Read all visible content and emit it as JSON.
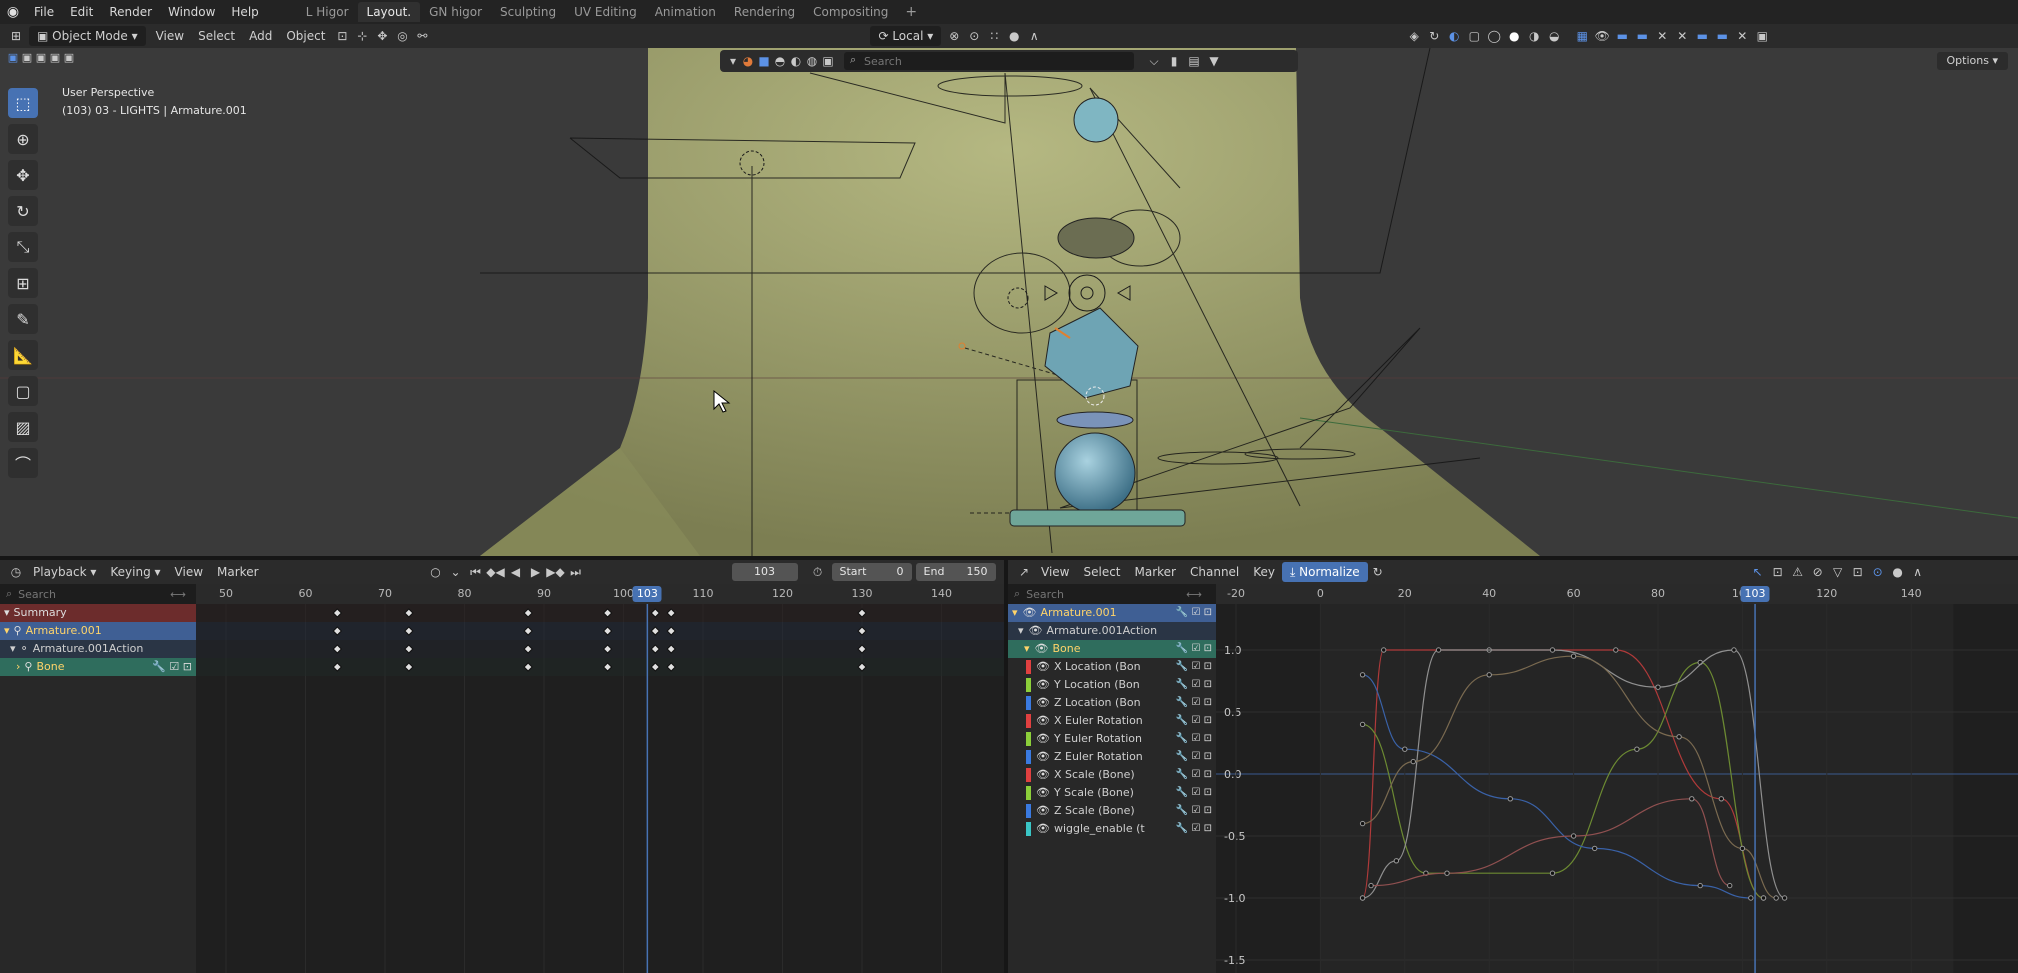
{
  "topbar": {
    "menus": [
      "File",
      "Edit",
      "Render",
      "Window",
      "Help"
    ],
    "workspaces": [
      "L Higor",
      "Layout.",
      "GN higor",
      "Sculpting",
      "UV Editing",
      "Animation",
      "Rendering",
      "Compositing"
    ],
    "active_workspace": "Layout."
  },
  "viewport_header": {
    "mode": "Object Mode",
    "menus": [
      "View",
      "Select",
      "Add",
      "Object"
    ],
    "transform_orientation": "Local",
    "options": "Options"
  },
  "viewport": {
    "perspective": "User Perspective",
    "context": "(103) 03 - LIGHTS | Armature.001",
    "search_placeholder": "Search"
  },
  "dopesheet_header": {
    "menus": [
      "Playback",
      "Keying",
      "View",
      "Marker"
    ],
    "current_frame": "103",
    "start_label": "Start",
    "start_value": "0",
    "end_label": "End",
    "end_value": "150"
  },
  "dopesheet": {
    "search_placeholder": "Search",
    "ruler": [
      50,
      60,
      70,
      80,
      90,
      100,
      110,
      120,
      130,
      140
    ],
    "current_frame": "103",
    "channels": [
      {
        "label": "Summary",
        "type": "summary"
      },
      {
        "label": "Armature.001",
        "type": "object"
      },
      {
        "label": "Armature.001Action",
        "type": "action"
      },
      {
        "label": "Bone",
        "type": "group"
      }
    ],
    "keyframes": [
      64,
      73,
      88,
      98,
      104,
      106,
      130
    ]
  },
  "graph_header": {
    "menus": [
      "View",
      "Select",
      "Marker",
      "Channel",
      "Key"
    ],
    "normalize": "Normalize"
  },
  "graph": {
    "search_placeholder": "Search",
    "ruler": [
      -20,
      0,
      20,
      40,
      60,
      80,
      100,
      120,
      140
    ],
    "current_frame": "103",
    "y_labels": [
      "1.0",
      "0.5",
      "0.0",
      "-0.5",
      "-1.0",
      "-1.5"
    ],
    "channels": [
      {
        "label": "Armature.001",
        "color": "#4d7ab8"
      },
      {
        "label": "Armature.001Action",
        "color": "#333"
      },
      {
        "label": "Bone",
        "color": "#2f6d5d"
      },
      {
        "label": "X Location (Bon",
        "color": "#e04040"
      },
      {
        "label": "Y Location (Bon",
        "color": "#8ccf3a"
      },
      {
        "label": "Z Location (Bon",
        "color": "#3a7ae0"
      },
      {
        "label": "X Euler Rotation",
        "color": "#e04040"
      },
      {
        "label": "Y Euler Rotation",
        "color": "#8ccf3a"
      },
      {
        "label": "Z Euler Rotation",
        "color": "#3a7ae0"
      },
      {
        "label": "X Scale (Bone)",
        "color": "#e04040"
      },
      {
        "label": "Y Scale (Bone)",
        "color": "#8ccf3a"
      },
      {
        "label": "Z Scale (Bone)",
        "color": "#3a7ae0"
      },
      {
        "label": "wiggle_enable (t",
        "color": "#3ac6c6"
      }
    ]
  }
}
